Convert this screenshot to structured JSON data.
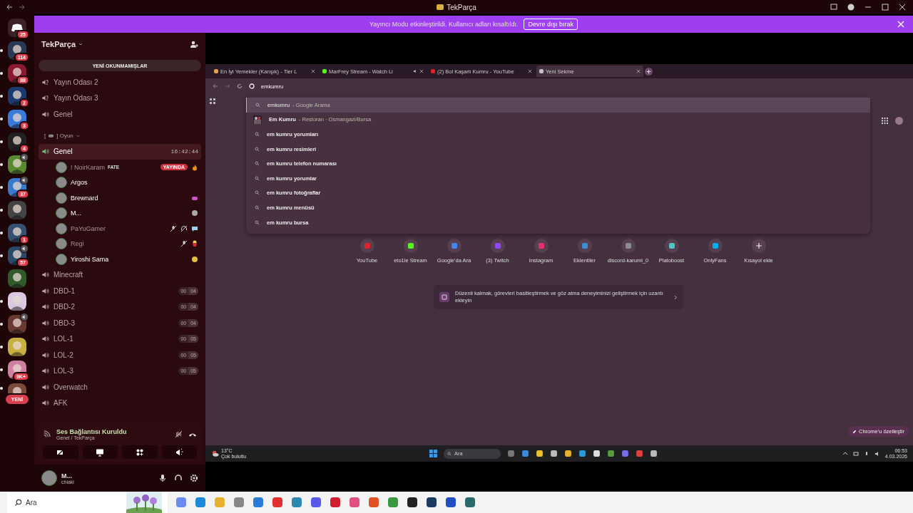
{
  "titlebar": {
    "title": "TekParça"
  },
  "servers": [
    {
      "kind": "home",
      "badge": "25",
      "unread": false,
      "voice": false
    },
    {
      "kind": "server",
      "badge": "114",
      "unread": true,
      "voice": false
    },
    {
      "kind": "server",
      "badge": "88",
      "unread": true,
      "voice": false
    },
    {
      "kind": "server",
      "badge": "2",
      "unread": true,
      "voice": false
    },
    {
      "kind": "server",
      "badge": "3",
      "unread": true,
      "voice": false
    },
    {
      "kind": "server",
      "badge": "4",
      "unread": true,
      "voice": false
    },
    {
      "kind": "server",
      "unread": true,
      "voice": true
    },
    {
      "kind": "server",
      "badge": "37",
      "unread": true,
      "voice": true
    },
    {
      "kind": "server",
      "unread": true,
      "voice": false
    },
    {
      "kind": "server",
      "badge": "1",
      "unread": true,
      "voice": false
    },
    {
      "kind": "server",
      "badge": "57",
      "unread": true,
      "voice": true
    },
    {
      "kind": "server",
      "unread": false,
      "voice": false
    },
    {
      "kind": "server",
      "unread": true,
      "voice": false
    },
    {
      "kind": "server",
      "unread": true,
      "voice": true
    },
    {
      "kind": "server",
      "unread": true,
      "voice": false
    },
    {
      "kind": "server",
      "badge": "9K+",
      "unread": true,
      "voice": false
    },
    {
      "kind": "server",
      "unread": true,
      "voice": false
    }
  ],
  "new_pill": "YENİ",
  "banner": {
    "text": "Yayıncı Modu etkinleştirildi. Kullanıcı adları kısaltıldı.",
    "button": "Devre dışı bırak"
  },
  "server_header": {
    "name": "TekParça"
  },
  "unread_bar": "YENİ OKUNMAMIŞLAR",
  "channels_top": [
    {
      "kind": "stage",
      "name": "Yayın Odası 2"
    },
    {
      "kind": "stage",
      "name": "Yayın Odası 3"
    },
    {
      "kind": "voice",
      "name": "Genel"
    }
  ],
  "category": {
    "open": "[",
    "label": "] Oyun"
  },
  "channels": [
    {
      "name": "Genel",
      "selected": true,
      "timer": "16:42:44",
      "members": [
        {
          "name": "! NoirKaram",
          "dimmed": true,
          "activity": "FATE",
          "live": "YAYINDA",
          "indicators": [
            {
              "kind": "fire"
            }
          ]
        },
        {
          "name": "Argos",
          "dimmed": false
        },
        {
          "name": "Brewnard",
          "dimmed": false,
          "indicators": [
            {
              "kind": "game"
            }
          ]
        },
        {
          "name": "M...",
          "dimmed": false,
          "indicators": [
            {
              "kind": "avatar"
            }
          ]
        },
        {
          "name": "PaYuGamer",
          "dimmed": true,
          "indicators": [
            {
              "kind": "muted"
            },
            {
              "kind": "deafened"
            },
            {
              "kind": "chat"
            }
          ]
        },
        {
          "name": "Regi",
          "dimmed": true,
          "indicators": [
            {
              "kind": "muted"
            },
            {
              "kind": "popcorn"
            }
          ]
        },
        {
          "name": "Yiroshi Sama",
          "dimmed": false,
          "indicators": [
            {
              "kind": "emoji"
            }
          ]
        }
      ]
    },
    {
      "name": "Minecraft",
      "selected": false
    },
    {
      "name": "DBD-1",
      "selected": false,
      "count": "00",
      "limit": "04"
    },
    {
      "name": "DBD-2",
      "selected": false,
      "count": "00",
      "limit": "04"
    },
    {
      "name": "DBD-3",
      "selected": false,
      "count": "00",
      "limit": "04"
    },
    {
      "name": "LOL-1",
      "selected": false,
      "count": "00",
      "limit": "05"
    },
    {
      "name": "LOL-2",
      "selected": false,
      "count": "00",
      "limit": "05"
    },
    {
      "name": "LOL-3",
      "selected": false,
      "count": "00",
      "limit": "05"
    },
    {
      "name": "Overwatch",
      "selected": false
    },
    {
      "name": "AFK",
      "selected": false
    }
  ],
  "voice_panel": {
    "status": "Ses Bağlantısı Kuruldu",
    "location": "Genel / TekParça"
  },
  "user": {
    "name": "M...",
    "status": "chiaki"
  },
  "stream": {
    "tabs": [
      {
        "title": "En İyi Yemekler (Karışık) - Tier L",
        "selected": false,
        "audio": false,
        "color": "#e8a040"
      },
      {
        "title": "MarFrey Stream - Watch Li",
        "selected": false,
        "audio": true,
        "color": "#53fc18"
      },
      {
        "title": "(2) Bol Kaşarlı Kumru - YouTube",
        "selected": false,
        "audio": false,
        "color": "#e0202a"
      },
      {
        "title": "Yeni Sekme",
        "selected": true,
        "audio": false,
        "color": "#c8c0c8"
      }
    ],
    "address": "emkumru",
    "suggestions": [
      {
        "kind": "typed",
        "query": "emkumru",
        "detail": "- Google Arama",
        "selected": true
      },
      {
        "kind": "place",
        "query": "Em Kumru",
        "detail": "- Restoran · Osmangazi/Bursa",
        "selected": false
      },
      {
        "kind": "suggestion",
        "query": "em kumru yorumları",
        "selected": false
      },
      {
        "kind": "suggestion",
        "query": "em kumru resimleri",
        "selected": false
      },
      {
        "kind": "suggestion",
        "query": "em kumru telefon numarası",
        "selected": false
      },
      {
        "kind": "suggestion",
        "query": "em kumru yorumlar",
        "selected": false
      },
      {
        "kind": "suggestion",
        "query": "em kumru fotoğraflar",
        "selected": false
      },
      {
        "kind": "suggestion",
        "query": "em kumru menüsü",
        "selected": false
      },
      {
        "kind": "suggestion",
        "query": "em kumru bursa",
        "selected": false
      }
    ],
    "shortcuts": [
      {
        "kind": "site",
        "label": "YouTube",
        "color": "#e0202a"
      },
      {
        "kind": "site",
        "label": "eto1le Stream",
        "color": "#53fc18"
      },
      {
        "kind": "site",
        "label": "Google'da Ara",
        "color": "#4285f4"
      },
      {
        "kind": "site",
        "label": "(3) Twitch",
        "color": "#9146ff"
      },
      {
        "kind": "site",
        "label": "Instagram",
        "color": "#e1306c"
      },
      {
        "kind": "site",
        "label": "Eklentiler",
        "color": "#3b8fd8"
      },
      {
        "kind": "site",
        "label": "discord-karumi_0",
        "color": "#8a8a9a"
      },
      {
        "kind": "site",
        "label": "Platoboost",
        "color": "#4fc3c8"
      },
      {
        "kind": "site",
        "label": "OnlyFans",
        "color": "#00aff0"
      },
      {
        "kind": "add",
        "label": "Kısayol ekle"
      }
    ],
    "promo": "Düzenli kalmak, görevleri basitleştirmek ve göz atma deneyiminizi geliştirmek için uzantı ekleyin",
    "customize": "Chrome'u özelleştir",
    "taskbar": {
      "temp": "13°C",
      "weather": "Çok bulutlu",
      "search": "Ara",
      "time": "06:53",
      "date": "4.03.2026"
    }
  },
  "taskbar": {
    "search": "Ara"
  }
}
